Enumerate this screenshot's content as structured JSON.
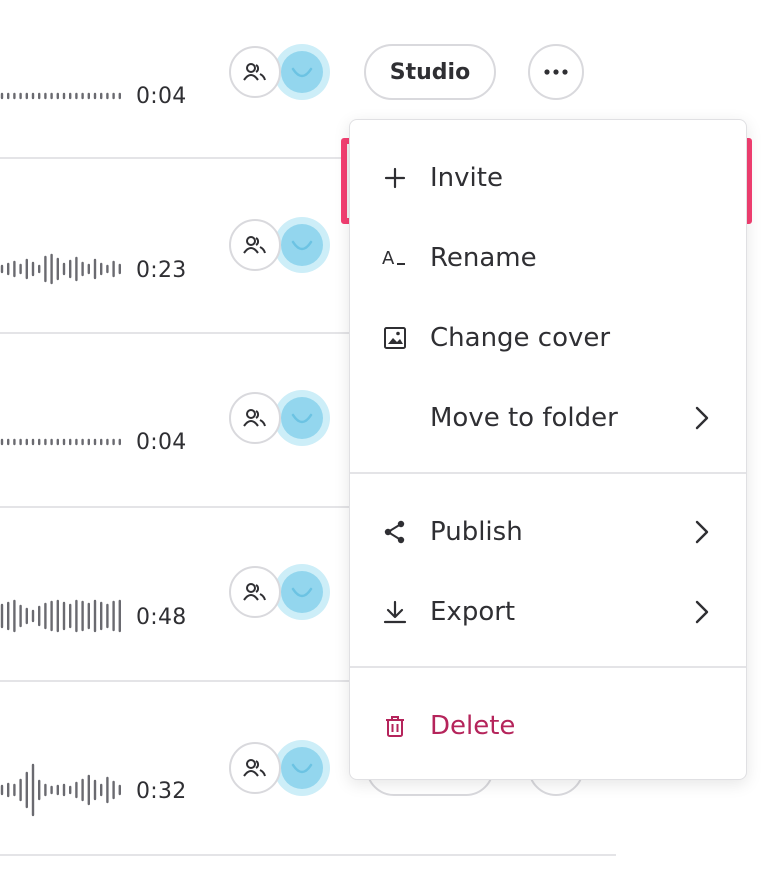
{
  "rows": [
    {
      "duration": "0:04",
      "wave": "flat"
    },
    {
      "duration": "0:23",
      "wave": "varied"
    },
    {
      "duration": "0:04",
      "wave": "flat"
    },
    {
      "duration": "0:48",
      "wave": "dense"
    },
    {
      "duration": "0:32",
      "wave": "spiky"
    }
  ],
  "icons": {
    "collaborators": "people-icon",
    "avatar": "smile-avatar",
    "more": "ellipsis-icon"
  },
  "studio_label": "Studio",
  "menu": {
    "items": [
      {
        "label": "Invite",
        "icon": "plus-icon",
        "submenu": false
      },
      {
        "label": "Rename",
        "icon": "rename-icon",
        "submenu": false
      },
      {
        "label": "Change cover",
        "icon": "image-icon",
        "submenu": false
      },
      {
        "label": "Move to folder",
        "icon": "",
        "submenu": true
      },
      {
        "label": "Publish",
        "icon": "share-icon",
        "submenu": true
      },
      {
        "label": "Export",
        "icon": "download-icon",
        "submenu": true
      },
      {
        "label": "Delete",
        "icon": "trash-icon",
        "submenu": false
      }
    ],
    "highlighted": "Invite"
  },
  "colors": {
    "highlight_border": "#f43f72",
    "delete": "#b5245b",
    "avatar": "#93d6ee"
  }
}
